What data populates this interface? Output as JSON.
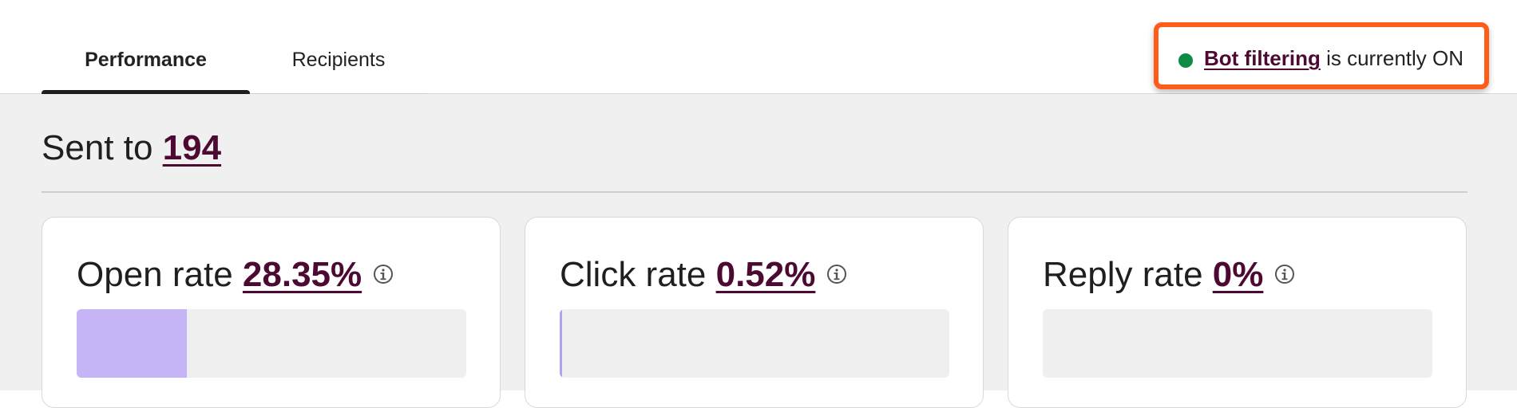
{
  "tabs": [
    {
      "label": "Performance",
      "active": true
    },
    {
      "label": "Recipients",
      "active": false
    }
  ],
  "bot_filtering": {
    "link_label": "Bot filtering",
    "status_text": " is currently ON",
    "status_color": "#0e8a44",
    "highlight_color": "#ff5c1a"
  },
  "sent": {
    "prefix": "Sent to ",
    "count": "194"
  },
  "metrics": [
    {
      "label": "Open rate ",
      "value": "28.35%",
      "fill_fraction": 0.2835,
      "info_icon": "info-icon"
    },
    {
      "label": "Click rate ",
      "value": "0.52%",
      "fill_fraction": 0.0052,
      "info_icon": "info-icon"
    },
    {
      "label": "Reply rate ",
      "value": "0%",
      "fill_fraction": 0,
      "info_icon": "info-icon"
    }
  ],
  "colors": {
    "link": "#4c0a33",
    "bar_fill": "#c6b5f6",
    "background": "#f0f0f0"
  }
}
